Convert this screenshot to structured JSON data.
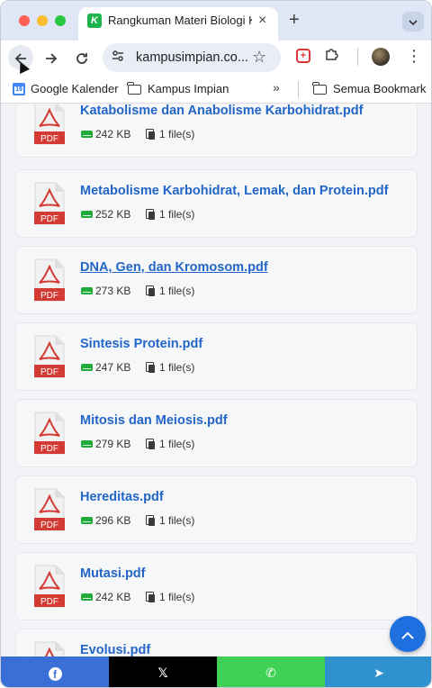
{
  "browser": {
    "tab_title": "Rangkuman Materi Biologi Kel",
    "tab_favicon_letter": "K",
    "new_tab": "+",
    "close": "×",
    "url": "kampusimpian.co...",
    "bookmarks": [
      {
        "label": "Google Kalender",
        "icon": "calendar-icon",
        "badge": "19"
      },
      {
        "label": "Kampus Impian",
        "icon": "folder-icon"
      }
    ],
    "bookmarks_overflow": "»",
    "all_bookmarks": "Semua Bookmark"
  },
  "files": [
    {
      "name": "Katabolisme dan Anabolisme Karbohidrat.pdf",
      "size": "242 KB",
      "count": "1 file(s)"
    },
    {
      "name": "Metabolisme Karbohidrat, Lemak, dan Protein.pdf",
      "size": "252 KB",
      "count": "1 file(s)"
    },
    {
      "name": "DNA, Gen, dan Kromosom.pdf",
      "size": "273 KB",
      "count": "1 file(s)"
    },
    {
      "name": "Sintesis Protein.pdf",
      "size": "247 KB",
      "count": "1 file(s)"
    },
    {
      "name": "Mitosis dan Meiosis.pdf",
      "size": "279 KB",
      "count": "1 file(s)"
    },
    {
      "name": "Hereditas.pdf",
      "size": "296 KB",
      "count": "1 file(s)"
    },
    {
      "name": "Mutasi.pdf",
      "size": "242 KB",
      "count": "1 file(s)"
    },
    {
      "name": "Evolusi.pdf",
      "size": "",
      "count": ""
    }
  ],
  "pdf_badge": "PDF",
  "share": [
    {
      "network": "facebook",
      "icon": "facebook-icon",
      "glyph": "f",
      "color": "#3a6fd8"
    },
    {
      "network": "x",
      "icon": "x-icon",
      "glyph": "𝕏",
      "color": "#000000"
    },
    {
      "network": "whatsapp",
      "icon": "whatsapp-icon",
      "glyph": "✆",
      "color": "#3fd156"
    },
    {
      "network": "telegram",
      "icon": "telegram-icon",
      "glyph": "➤",
      "color": "#2f92cf"
    }
  ],
  "colors": {
    "link": "#2366c7",
    "pdf_red": "#d33a33",
    "size_icon": "#1faa3a",
    "fab": "#1e6fe0"
  }
}
